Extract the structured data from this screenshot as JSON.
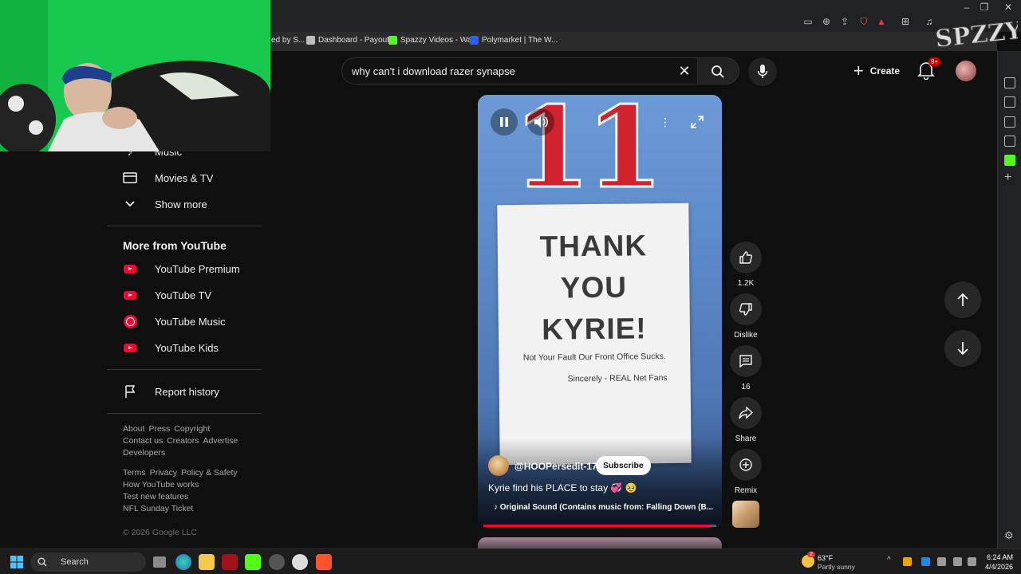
{
  "browser": {
    "bookmarks": [
      {
        "label": "ed by S...",
        "icon": "page-icon",
        "color": "#6b6b6b"
      },
      {
        "label": "Dashboard - Payout...",
        "icon": "page-icon",
        "color": "#bdbdbd"
      },
      {
        "label": "Spazzy Videos - Wa...",
        "icon": "kick-icon",
        "color": "#53fc18"
      },
      {
        "label": "Polymarket | The W...",
        "icon": "polymarket-icon",
        "color": "#2e5cff"
      }
    ],
    "notification_badge": "1"
  },
  "search": {
    "query": "why can't i download razer synapse"
  },
  "header": {
    "create_label": "Create",
    "notifications_badge": "9+"
  },
  "sidebar": {
    "top_items": [
      {
        "label": "Music",
        "icon": "music-icon"
      },
      {
        "label": "Movies & TV",
        "icon": "clapperboard-icon"
      },
      {
        "label": "Show more",
        "icon": "chevron-down-icon"
      }
    ],
    "more_heading": "More from YouTube",
    "more_items": [
      {
        "label": "YouTube Premium",
        "icon": "youtube-premium-icon"
      },
      {
        "label": "YouTube TV",
        "icon": "youtube-tv-icon"
      },
      {
        "label": "YouTube Music",
        "icon": "youtube-music-icon"
      },
      {
        "label": "YouTube Kids",
        "icon": "youtube-kids-icon"
      }
    ],
    "report_history": "Report history",
    "footer1": [
      "About",
      "Press",
      "Copyright",
      "Contact us",
      "Creators",
      "Advertise",
      "Developers"
    ],
    "footer2": [
      "Terms",
      "Privacy",
      "Policy & Safety",
      "How YouTube works",
      "Test new features",
      "NFL Sunday Ticket"
    ],
    "copyright": "© 2026 Google LLC"
  },
  "video": {
    "jersey_number": "11",
    "sign_line1": "THANK",
    "sign_line2": "YOU",
    "sign_line3": "KYRIE!",
    "sign_sub": "Not Your Fault Our Front Office Sucks.",
    "sign_signature": "Sincerely - REAL Net Fans",
    "channel": "@HOOPersedit-17",
    "subscribe_label": "Subscribe",
    "title": "Kyrie find his PLACE to stay 💞 🥹",
    "sound": "Original Sound (Contains music from: Falling Down (B...",
    "progress": 0.97
  },
  "actions": {
    "likes": "1.2K",
    "dislike": "Dislike",
    "comments": "16",
    "share": "Share",
    "remix": "Remix"
  },
  "taskbar": {
    "search_label": "Search",
    "weather_temp": "63°F",
    "weather_desc": "Partly sunny",
    "weather_badge": "2",
    "time": "6:24 AM",
    "date": "4/4/2026"
  },
  "colors": {
    "youtube_red": "#ff0033",
    "background": "#0f0f0f",
    "webcam_green": "#18c04c"
  }
}
